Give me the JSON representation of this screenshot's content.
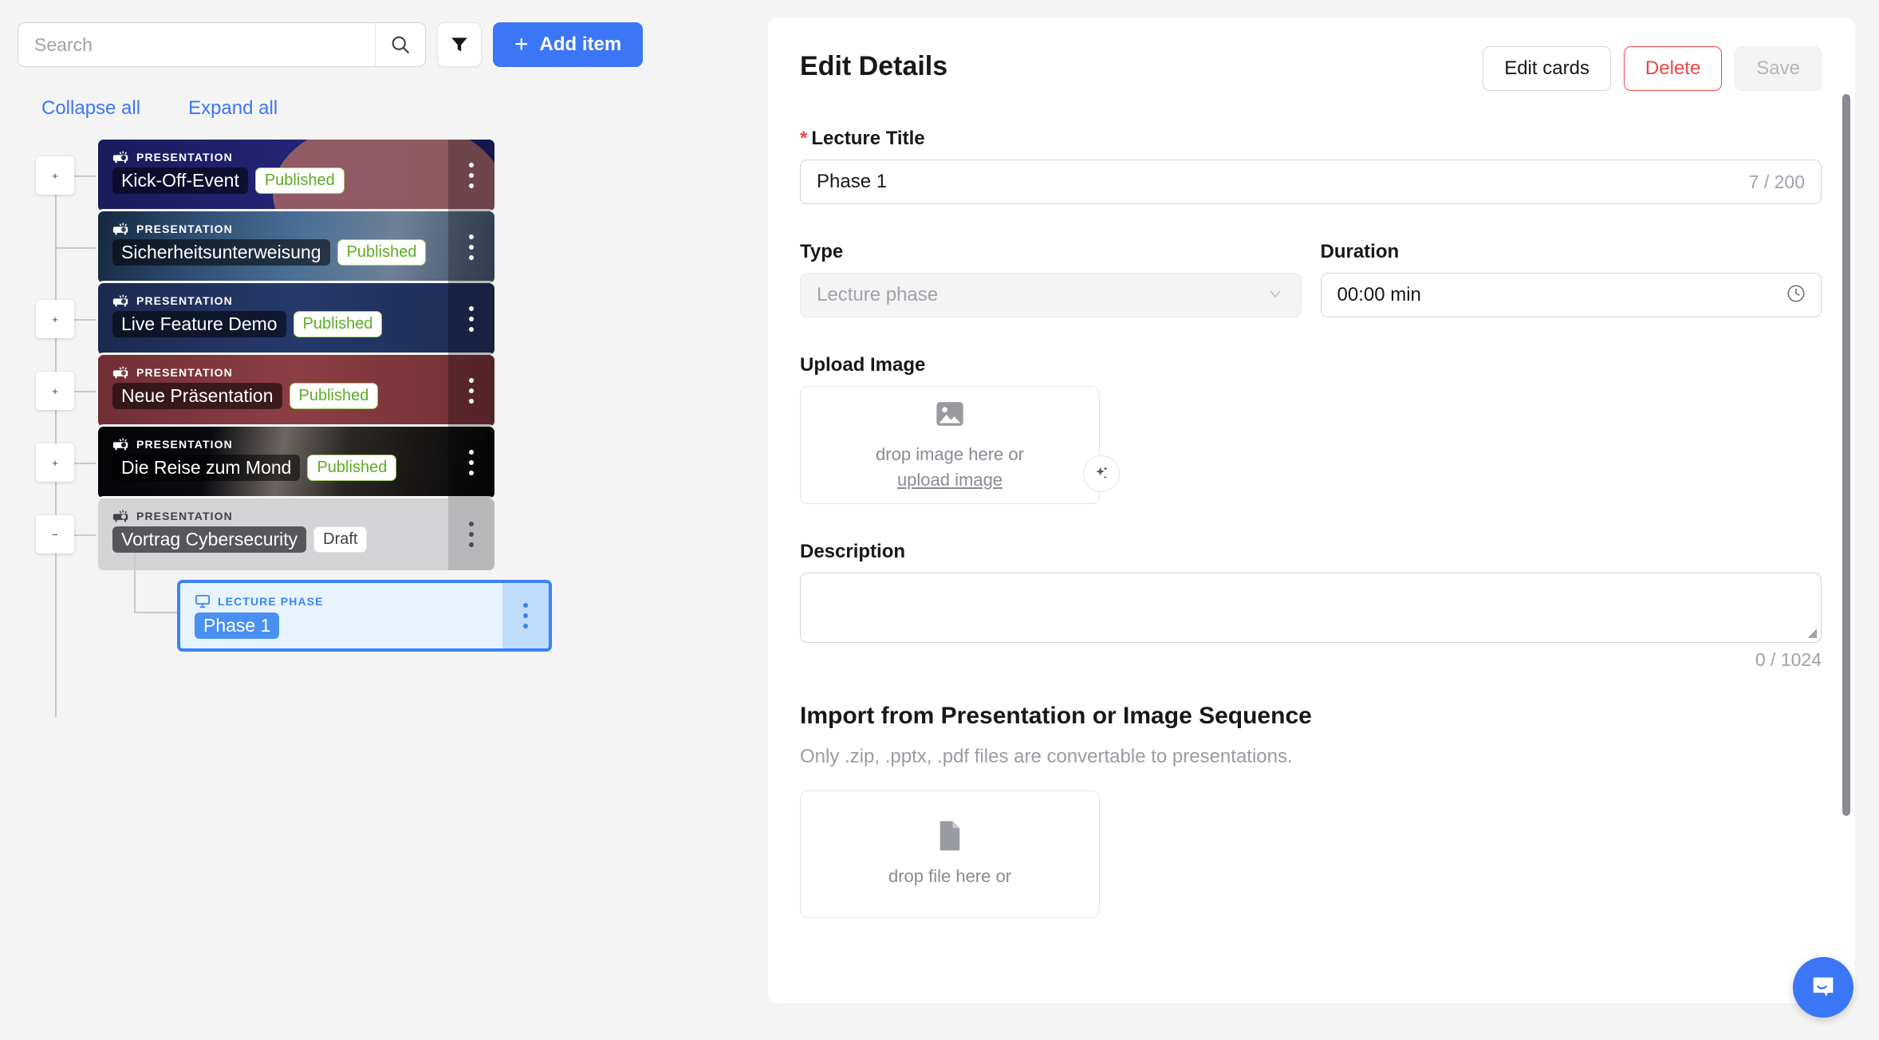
{
  "toolbar": {
    "search_placeholder": "Search",
    "search_value": "",
    "search_icon": "search-icon",
    "filter_icon": "filter-icon",
    "add_label": "Add item",
    "add_plus": "+"
  },
  "tree_controls": {
    "collapse_all": "Collapse all",
    "expand_all": "Expand all"
  },
  "tree": {
    "items": [
      {
        "kind": "PRESENTATION",
        "title": "Kick-Off-Event",
        "badge": "Published",
        "toggle": "+"
      },
      {
        "kind": "PRESENTATION",
        "title": "Sicherheitsunterweisung",
        "badge": "Published",
        "toggle": ""
      },
      {
        "kind": "PRESENTATION",
        "title": "Live Feature Demo",
        "badge": "Published",
        "toggle": "+"
      },
      {
        "kind": "PRESENTATION",
        "title": "Neue Präsentation",
        "badge": "Published",
        "toggle": "+"
      },
      {
        "kind": "PRESENTATION",
        "title": "Die Reise zum Mond",
        "badge": "Published",
        "toggle": "+"
      },
      {
        "kind": "PRESENTATION",
        "title": "Vortrag Cybersecurity",
        "badge": "Draft",
        "toggle": "−"
      }
    ],
    "child": {
      "kind": "LECTURE PHASE",
      "title": "Phase 1"
    }
  },
  "panel": {
    "title": "Edit Details",
    "edit_cards_label": "Edit cards",
    "delete_label": "Delete",
    "save_label": "Save",
    "lecture_title": {
      "label": "Lecture Title",
      "required_mark": "*",
      "value": "Phase 1",
      "counter": "7 / 200"
    },
    "type": {
      "label": "Type",
      "value": "Lecture phase"
    },
    "duration": {
      "label": "Duration",
      "value": "00:00 min",
      "icon": "clock-icon"
    },
    "upload_image": {
      "label": "Upload Image",
      "drop_text": "drop image here or",
      "link_text": "upload image",
      "icon": "image-icon",
      "magic_icon": "sparkles-icon"
    },
    "description": {
      "label": "Description",
      "value": "",
      "counter": "0 / 1024"
    },
    "import": {
      "title": "Import from Presentation or Image Sequence",
      "subtitle": "Only .zip, .pptx, .pdf files are convertable to presentations.",
      "drop_text": "drop file here or",
      "icon": "file-icon"
    }
  },
  "chat": {
    "icon": "chat-bubble-icon"
  },
  "colors": {
    "accent": "#3b76f6",
    "danger": "#ef4444",
    "published": "#5cab22",
    "selected_border": "#3b82f6"
  }
}
